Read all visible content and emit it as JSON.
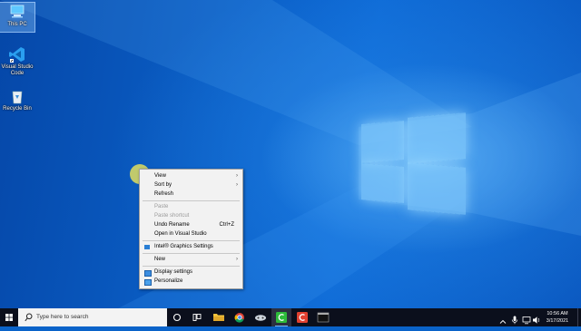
{
  "desktop_icons": [
    {
      "label": "This PC"
    },
    {
      "label": "Visual Studio Code"
    },
    {
      "label": "Recycle Bin"
    }
  ],
  "context_menu": {
    "view": "View",
    "sort_by": "Sort by",
    "refresh": "Refresh",
    "paste": "Paste",
    "paste_shortcut": "Paste shortcut",
    "undo_rename": "Undo Rename",
    "undo_rename_shortcut": "Ctrl+Z",
    "open_in_vs": "Open in Visual Studio",
    "intel_graphics": "Intel® Graphics Settings",
    "new": "New",
    "display_settings": "Display settings",
    "personalize": "Personalize"
  },
  "taskbar": {
    "search_placeholder": "Type here to search",
    "time": "10:56 AM",
    "date": "3/17/2021"
  },
  "colors": {
    "taskbar": "#0b0f1c",
    "desktop": "#0a5dc4",
    "menu_bg": "#f2f2f2",
    "cursor_highlight": "#ffee50"
  }
}
